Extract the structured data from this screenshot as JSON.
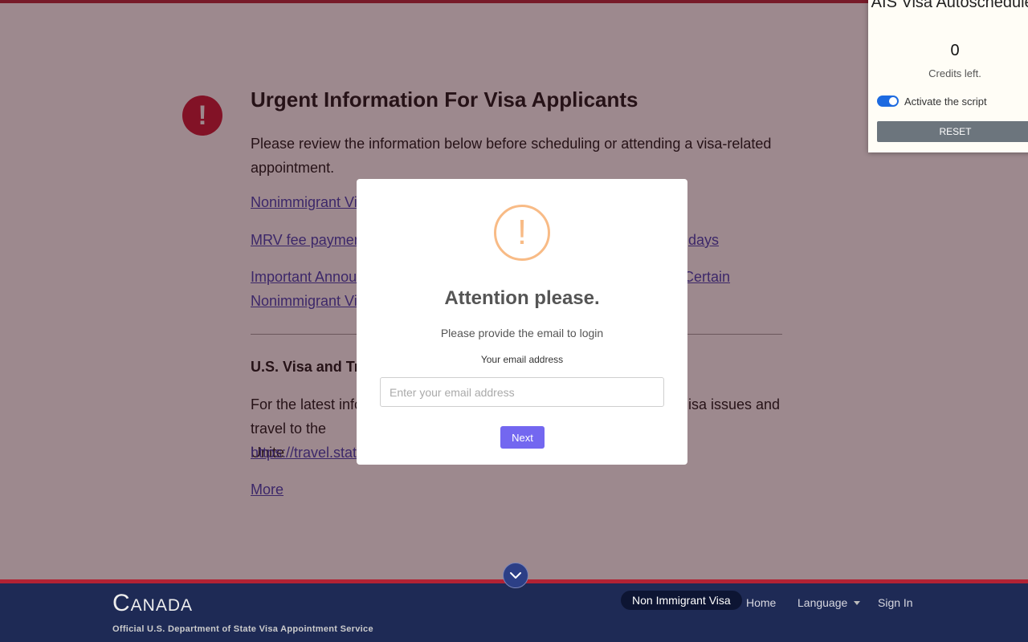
{
  "urgent": {
    "title": "Urgent Information For Visa Applicants",
    "intro": "Please review the information below before scheduling or attending a visa-related appointment.",
    "links": [
      {
        "left": "Nonimmigrant Vis",
        "right": ""
      },
      {
        "left": "MRV fee paymen",
        "right": "days"
      },
      {
        "left": "Important Announ",
        "right": "Certain"
      },
      {
        "left": "Nonimmigrant Vis",
        "right": ""
      }
    ]
  },
  "travel": {
    "heading": "U.S. Visa and Tra",
    "text_left_1": "For the latest info",
    "text_right_1": "isa issues and",
    "text_left_2": "travel to the Unite",
    "url": "https://travel.state",
    "more": "More"
  },
  "footer": {
    "country": "Canada",
    "subtitle": "Official U.S. Department of State Visa Appointment Service",
    "nav": {
      "visa_type": "Non Immigrant Visa",
      "home": "Home",
      "language": "Language",
      "sign_in": "Sign In"
    }
  },
  "modal": {
    "icon": "!",
    "title": "Attention please.",
    "text": "Please provide the email to login",
    "label": "Your email address",
    "input_placeholder": "Enter your email address",
    "input_value": "",
    "button": "Next"
  },
  "extension": {
    "title": "AIS Visa Autoscheduler",
    "credits": "0",
    "credits_label": "Credits left.",
    "toggle_label": "Activate the script",
    "toggle_on": true,
    "reset": "RESET"
  },
  "colors": {
    "brand_red": "#b22234",
    "footer_navy": "#1e2a55",
    "link": "#3c3bb5",
    "modal_button": "#7367f0",
    "warning": "#f8bb86",
    "toggle": "#1d6ae0"
  }
}
